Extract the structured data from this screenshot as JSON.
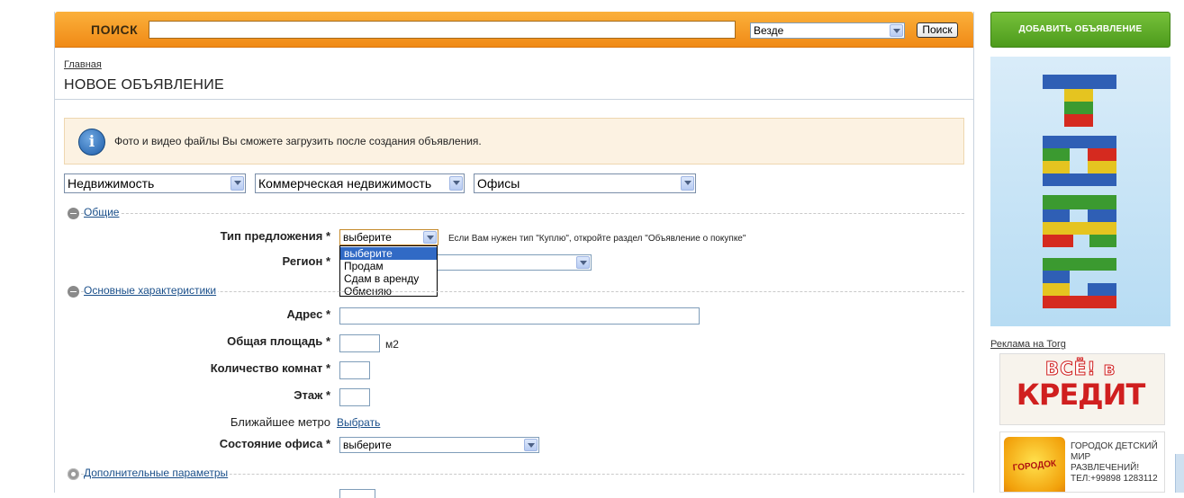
{
  "search": {
    "label": "ПОИСК",
    "query": "",
    "scope_selected": "Везде",
    "button": "Поиск"
  },
  "breadcrumb": "Главная",
  "page_title": "НОВОЕ ОБЪЯВЛЕНИЕ",
  "notice": "Фото и видео файлы Вы сможете загрузить после создания объявления.",
  "categories": {
    "level1": "Недвижимость",
    "level2": "Коммерческая недвижимость",
    "level3": "Офисы"
  },
  "sections": {
    "general": "Общие",
    "main_specs": "Основные характеристики",
    "extra_params": "Дополнительные параметры"
  },
  "fields": {
    "offer_type": {
      "label": "Тип предложения",
      "required": "*",
      "value": "выберите",
      "hint": "Если Вам нужен тип \"Куплю\", откройте раздел \"Объявление о покупке\"",
      "options": [
        "выберите",
        "Продам",
        "Сдам в аренду",
        "Обменяю"
      ]
    },
    "region": {
      "label": "Регион",
      "required": "*",
      "value": ""
    },
    "address": {
      "label": "Адрес",
      "required": "*",
      "value": ""
    },
    "area": {
      "label": "Общая площадь",
      "required": "*",
      "value": "",
      "unit": "м2"
    },
    "rooms": {
      "label": "Количество комнат",
      "required": "*",
      "value": ""
    },
    "floor": {
      "label": "Этаж",
      "required": "*",
      "value": ""
    },
    "metro": {
      "label": "Ближайшее метро",
      "link": "Выбрать"
    },
    "office_state": {
      "label": "Состояние офиса",
      "required": "*",
      "value": "выберите"
    }
  },
  "sidebar": {
    "add_button": "ДОБАВИТЬ ОБЪЯВЛЕНИЕ",
    "ad_label": "Реклама на Torg",
    "ad2_top": "ВСЁ! в",
    "ad2_main": "КРЕДИТ",
    "ad3_logo": "ГОРОДОК",
    "ad3_text": "ГОРОДОК ДЕТСКИЙ МИР РАЗВЛЕЧЕНИЙ! ТЕЛ:+99898 1283112"
  },
  "colors": {
    "search_bar": "#f39a22",
    "add_button": "#5ea928",
    "link": "#1a4f8a",
    "selected_option": "#316ac5",
    "notice_bg": "#fcf2e2"
  },
  "icons": [
    "info-icon",
    "collapse-icon",
    "gear-icon",
    "dropdown-arrow-icon"
  ]
}
